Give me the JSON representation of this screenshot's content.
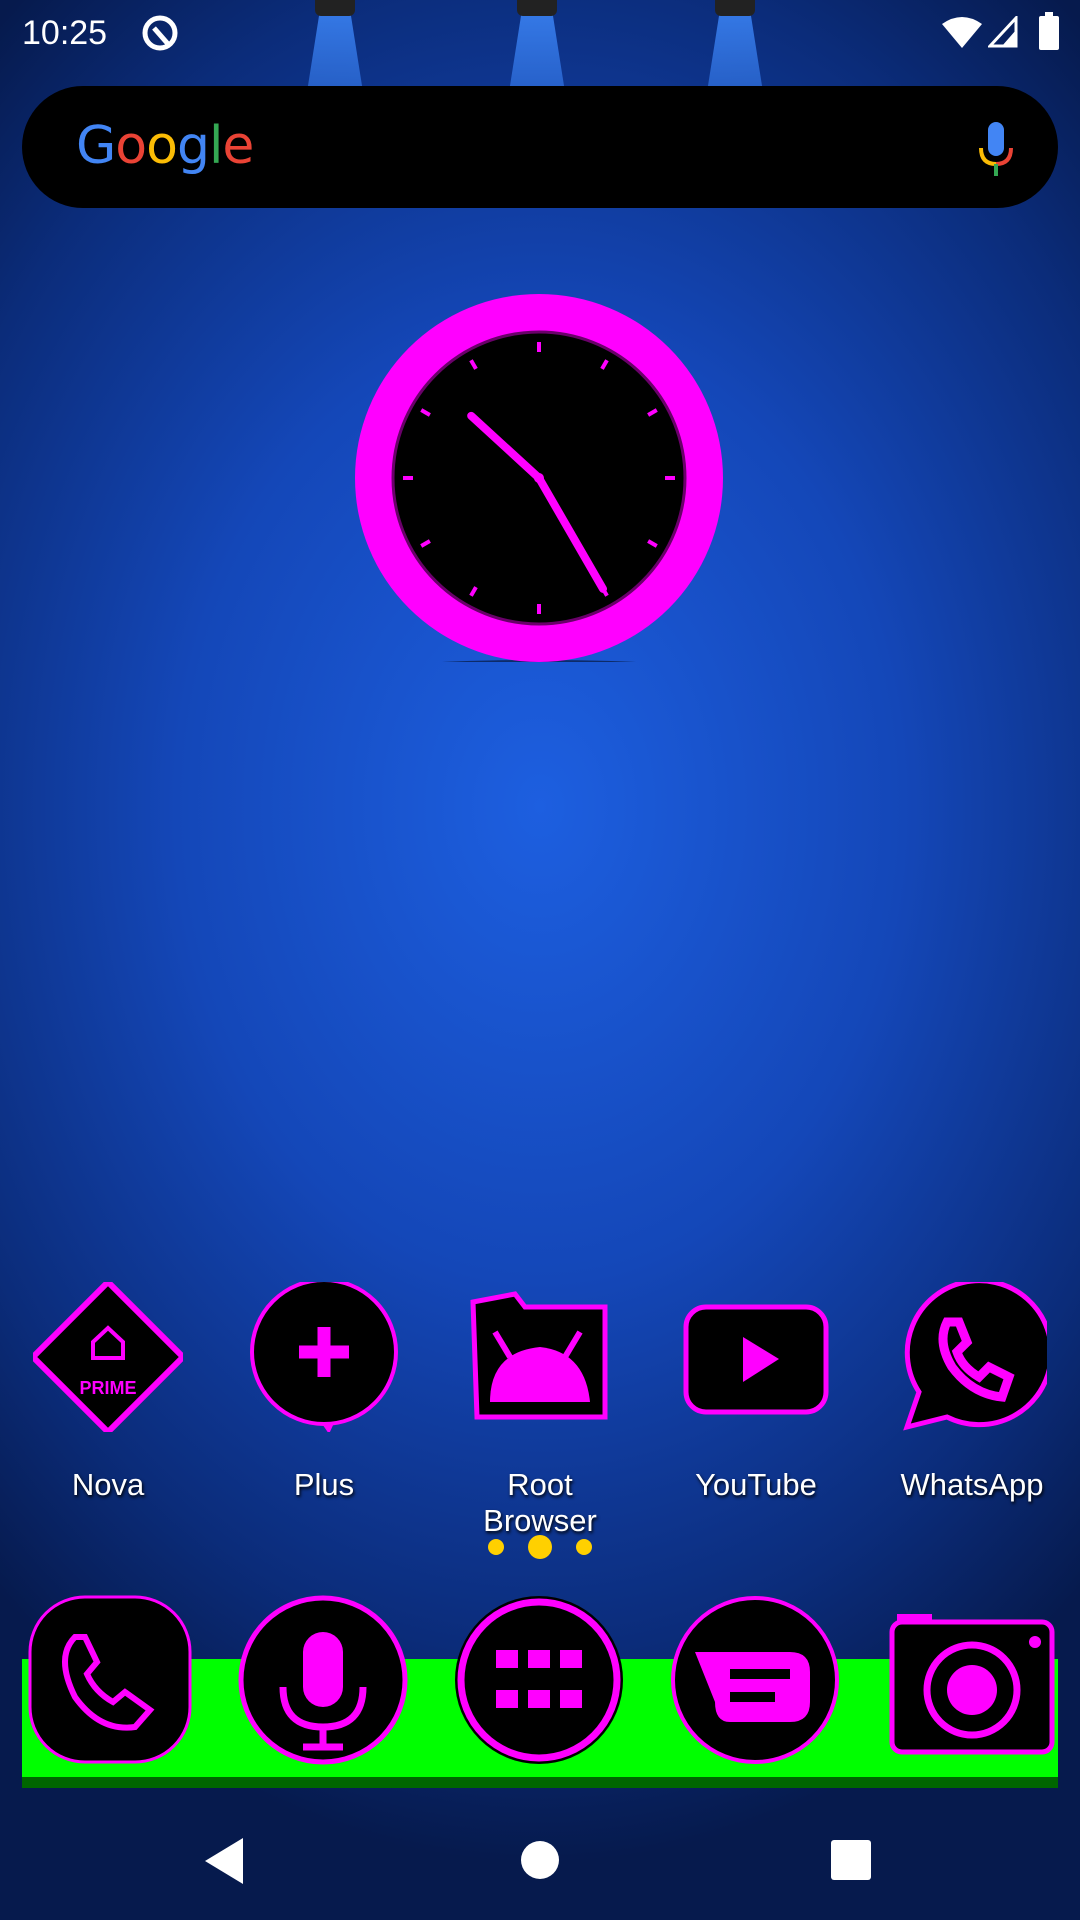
{
  "status_bar": {
    "time": "10:25",
    "icons": [
      "nova-q-icon",
      "wifi-icon",
      "signal-icon",
      "battery-icon"
    ]
  },
  "search": {
    "logo": "Google",
    "mic": "mic-icon"
  },
  "clock": {
    "hour": 10,
    "minute": 25,
    "ring_color": "#ff00ff"
  },
  "apps": [
    {
      "label": "Nova",
      "icon": "nova-prime-icon"
    },
    {
      "label": "Plus",
      "icon": "plus-messenger-icon"
    },
    {
      "label": "Root Browser",
      "icon": "root-browser-icon"
    },
    {
      "label": "YouTube",
      "icon": "youtube-icon"
    },
    {
      "label": "WhatsApp",
      "icon": "whatsapp-icon"
    }
  ],
  "page_indicator": {
    "pages": 3,
    "current": 1
  },
  "dock": [
    {
      "icon": "phone-icon"
    },
    {
      "icon": "voice-search-icon"
    },
    {
      "icon": "app-drawer-icon"
    },
    {
      "icon": "messages-icon"
    },
    {
      "icon": "camera-icon"
    }
  ],
  "nav": [
    "back-button",
    "home-button",
    "recents-button"
  ],
  "colors": {
    "accent": "#ff00ff",
    "shelf": "#00ff00",
    "dots": "#ffd000"
  }
}
